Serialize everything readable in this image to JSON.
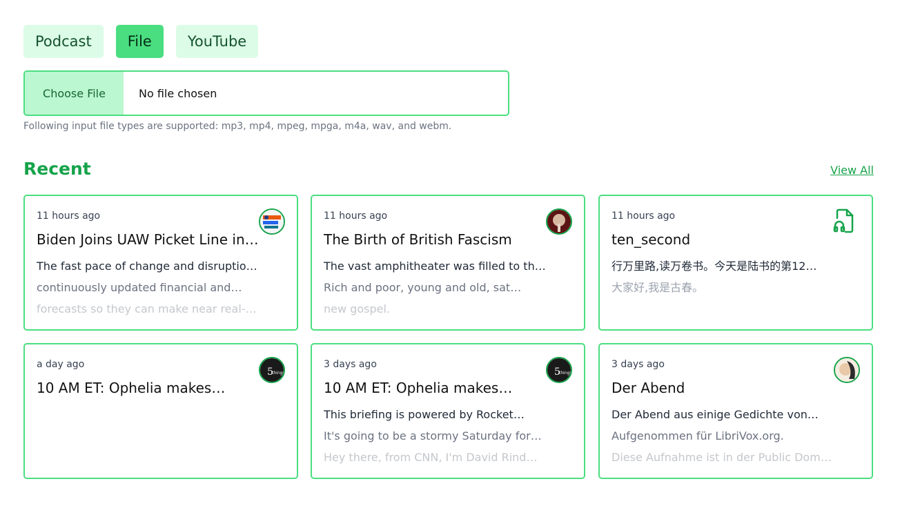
{
  "tabs": [
    {
      "label": "Podcast",
      "active": false
    },
    {
      "label": "File",
      "active": true
    },
    {
      "label": "YouTube",
      "active": false
    }
  ],
  "file_input": {
    "button_label": "Choose File",
    "status": "No file chosen",
    "hint": "Following input file types are supported: mp3, mp4, mpeg, mpga, m4a, wav, and webm."
  },
  "recent": {
    "title": "Recent",
    "view_all": "View All",
    "cards": [
      {
        "time": "11 hours ago",
        "title": "Biden Joins UAW Picket Line in…",
        "lines": [
          "The fast pace of change and disruption…",
          "continuously updated financial and…",
          "forecasts so they can make near real-…"
        ],
        "icon": "podcast-cover-icon"
      },
      {
        "time": "11 hours ago",
        "title": "The Birth of British Fascism",
        "lines": [
          "The vast amphitheater was filled to the…",
          "Rich and poor, young and old, sat…",
          "new gospel."
        ],
        "icon": "podcast-cover-icon"
      },
      {
        "time": "11 hours ago",
        "title": "ten_second",
        "lines": [
          "行万里路,读万卷书。今天是陆书的第12…",
          "大家好,我是古春。",
          ""
        ],
        "icon": "audio-file-icon"
      },
      {
        "time": "a day ago",
        "title": "10 AM ET: Ophelia makes…",
        "lines": [
          "",
          "",
          ""
        ],
        "icon": "podcast-cover-icon"
      },
      {
        "time": "3 days ago",
        "title": "10 AM ET: Ophelia makes…",
        "lines": [
          "This briefing is powered by Rocket…",
          "It's going to be a stormy Saturday for…",
          "Hey there, from CNN, I'm David Rind…"
        ],
        "icon": "podcast-cover-icon"
      },
      {
        "time": "3 days ago",
        "title": "Der Abend",
        "lines": [
          "Der Abend aus einige Gedichte von…",
          "Aufgenommen für LibriVox.org.",
          "Diese Aufnahme ist in der Public Domain."
        ],
        "icon": "podcast-cover-icon"
      }
    ]
  },
  "colors": {
    "accent": "#16a34a",
    "border": "#4ade80",
    "tab_bg": "#dcfce7",
    "tab_active_bg": "#4ade80"
  }
}
